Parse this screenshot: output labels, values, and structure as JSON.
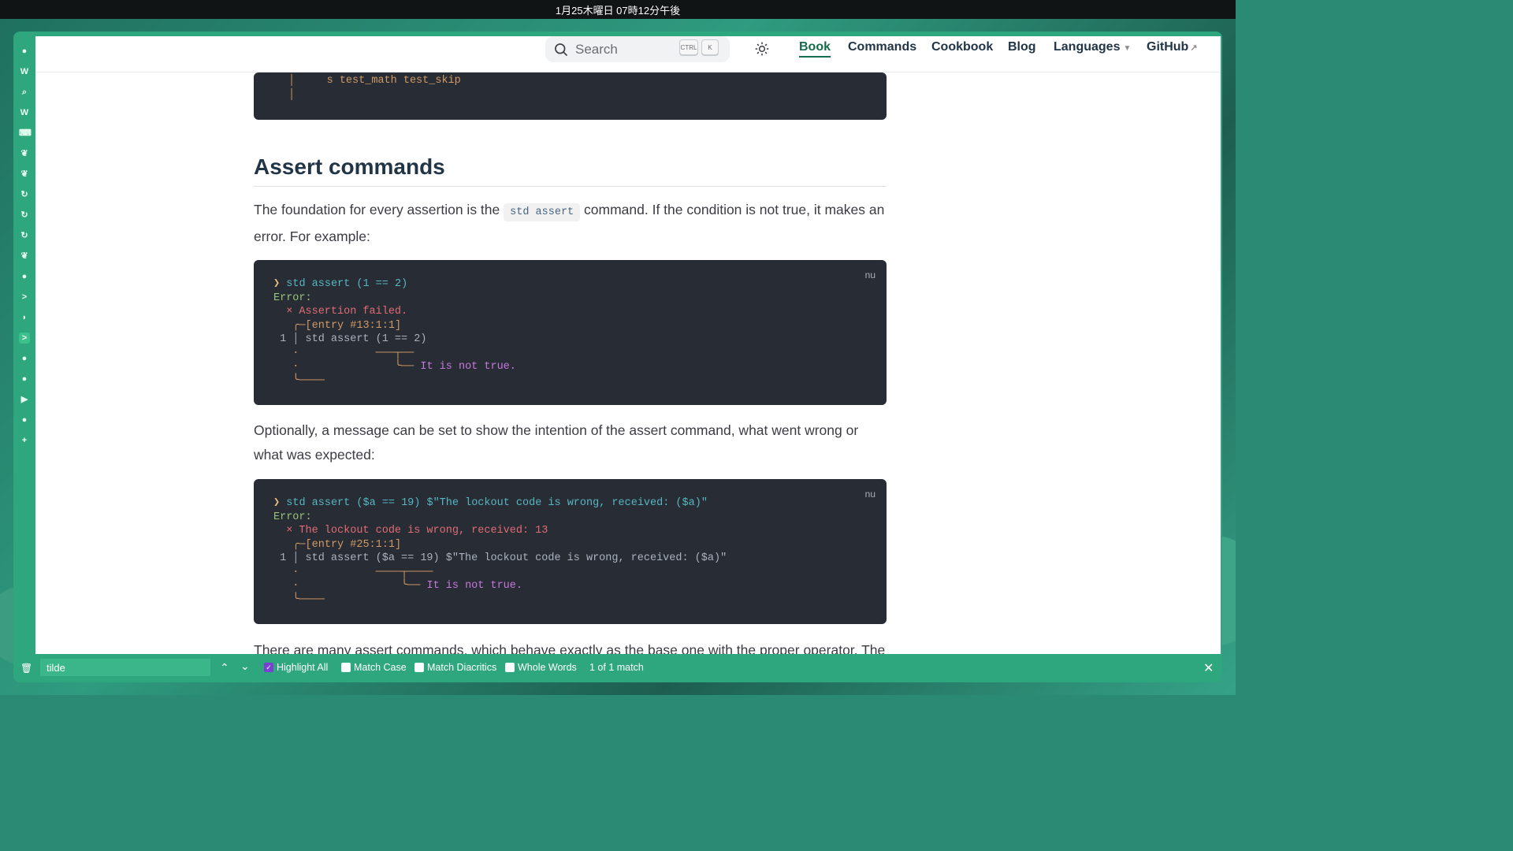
{
  "system": {
    "clock": "1月25木曜日 07時12分午後"
  },
  "sidebar": {
    "icons": [
      "bookmark-icon",
      "wikipedia-icon",
      "search-icon",
      "wikipedia-icon",
      "keyboard-icon",
      "leaf-icon",
      "leaf-icon",
      "history-icon",
      "history-icon",
      "history-icon",
      "leaf-icon",
      "github-icon",
      "terminal-icon",
      "arc-icon",
      "terminal-icon",
      "github-icon",
      "github-icon",
      "youtube-icon",
      "github-icon",
      "add-icon"
    ],
    "glyphs": [
      "●",
      "W",
      "⌕",
      "W",
      "⌨",
      "❦",
      "❦",
      "↻",
      "↻",
      "↻",
      "❦",
      "●",
      ">",
      "◗",
      ">",
      "●",
      "●",
      "▶",
      "●",
      "+"
    ]
  },
  "navbar": {
    "search_placeholder": "Search",
    "kbd_ctrl": "CTRL",
    "kbd_k": "K",
    "links": {
      "book": "Book",
      "commands": "Commands",
      "cookbook": "Cookbook",
      "blog": "Blog",
      "languages": "Languages",
      "github": "GitHub"
    }
  },
  "doc": {
    "prev_code": {
      "line1": "s test_math test_skip"
    },
    "heading": "Assert commands",
    "para1_before": "The foundation for every assertion is the",
    "para1_code": "std assert",
    "para1_after": "command. If the condition is not true, it makes an error. For example:",
    "code1": {
      "lang": "nu",
      "prompt": "❯",
      "cmd": "std assert (1 == 2)",
      "error": "Error:",
      "fail": "× Assertion failed.",
      "entry": "╭─[entry #13:1:1]",
      "line": " 1 │ std assert (1 == 2)",
      "dot1": "   ·            ───┬──",
      "dot2": "   ·               ╰── ",
      "note": "It is not true.",
      "end": "   ╰────"
    },
    "para2": "Optionally, a message can be set to show the intention of the assert command, what went wrong or what was expected:",
    "code2": {
      "lang": "nu",
      "prompt": "❯",
      "cmd": "std assert ($a == 19) $\"The lockout code is wrong, received: ($a)\"",
      "error": "Error:",
      "fail": "× The lockout code is wrong, received: 13",
      "entry": "╭─[entry #25:1:1]",
      "line": " 1 │ std assert ($a == 19) $\"The lockout code is wrong, received: ($a)\"",
      "dot1": "   ·            ────┬────",
      "dot2": "   ·                ╰── ",
      "note": "It is not true.",
      "end": "   ╰────"
    },
    "para3": "There are many assert commands, which behave exactly as the base one with the proper operator. The"
  },
  "findbar": {
    "query": "tilde",
    "highlight_all": "Highlight All",
    "match_case": "Match Case",
    "match_diacritics": "Match Diacritics",
    "whole_words": "Whole Words",
    "status": "1 of 1 match"
  }
}
